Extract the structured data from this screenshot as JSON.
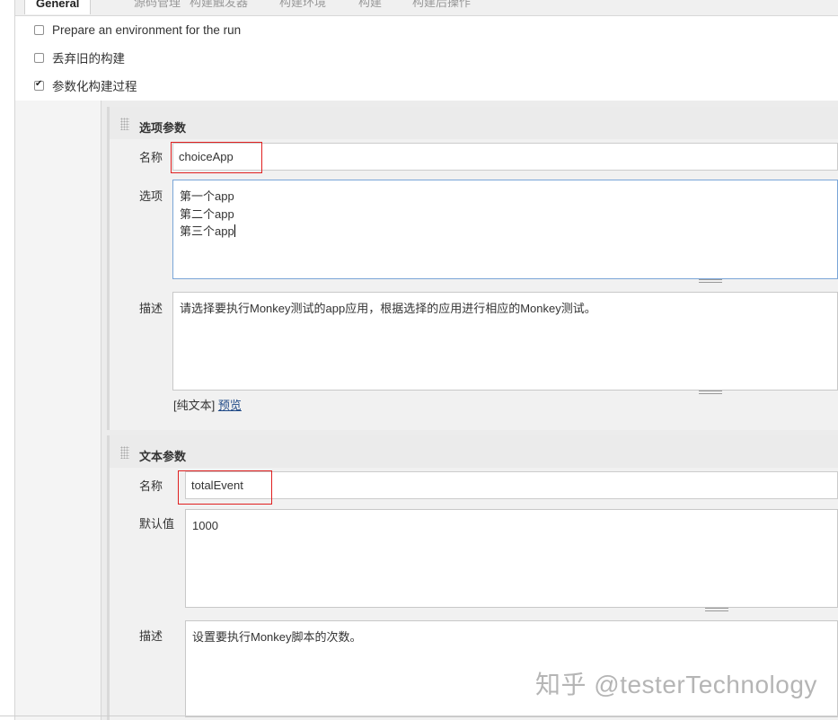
{
  "tabs": [
    {
      "label": "General",
      "active": true
    },
    {
      "label": "源码管理"
    },
    {
      "label": "构建触发器"
    },
    {
      "label": "构建环境"
    },
    {
      "label": "构建"
    },
    {
      "label": "构建后操作"
    }
  ],
  "options": [
    {
      "label": "Prepare an environment for the run",
      "checked": false
    },
    {
      "label": "丢弃旧的构建",
      "checked": false
    },
    {
      "label": "参数化构建过程",
      "checked": true
    }
  ],
  "choice_param": {
    "title": "选项参数",
    "name_label": "名称",
    "name_value": "choiceApp",
    "choices_label": "选项",
    "choices": [
      "第一个app",
      "第二个app",
      "第三个app"
    ],
    "desc_label": "描述",
    "desc_value": "请选择要执行Monkey测试的app应用，根据选择的应用进行相应的Monkey测试。",
    "format_label": "[纯文本]",
    "preview_label": "预览"
  },
  "string_param": {
    "title": "文本参数",
    "name_label": "名称",
    "name_value": "totalEvent",
    "default_label": "默认值",
    "default_value": "1000",
    "desc_label": "描述",
    "desc_value": "设置要执行Monkey脚本的次数。"
  },
  "watermark": "知乎 @testerTechnology",
  "colors": {
    "highlight": "#e02020",
    "focus_border": "#7aa5d8",
    "link": "#204a87"
  }
}
